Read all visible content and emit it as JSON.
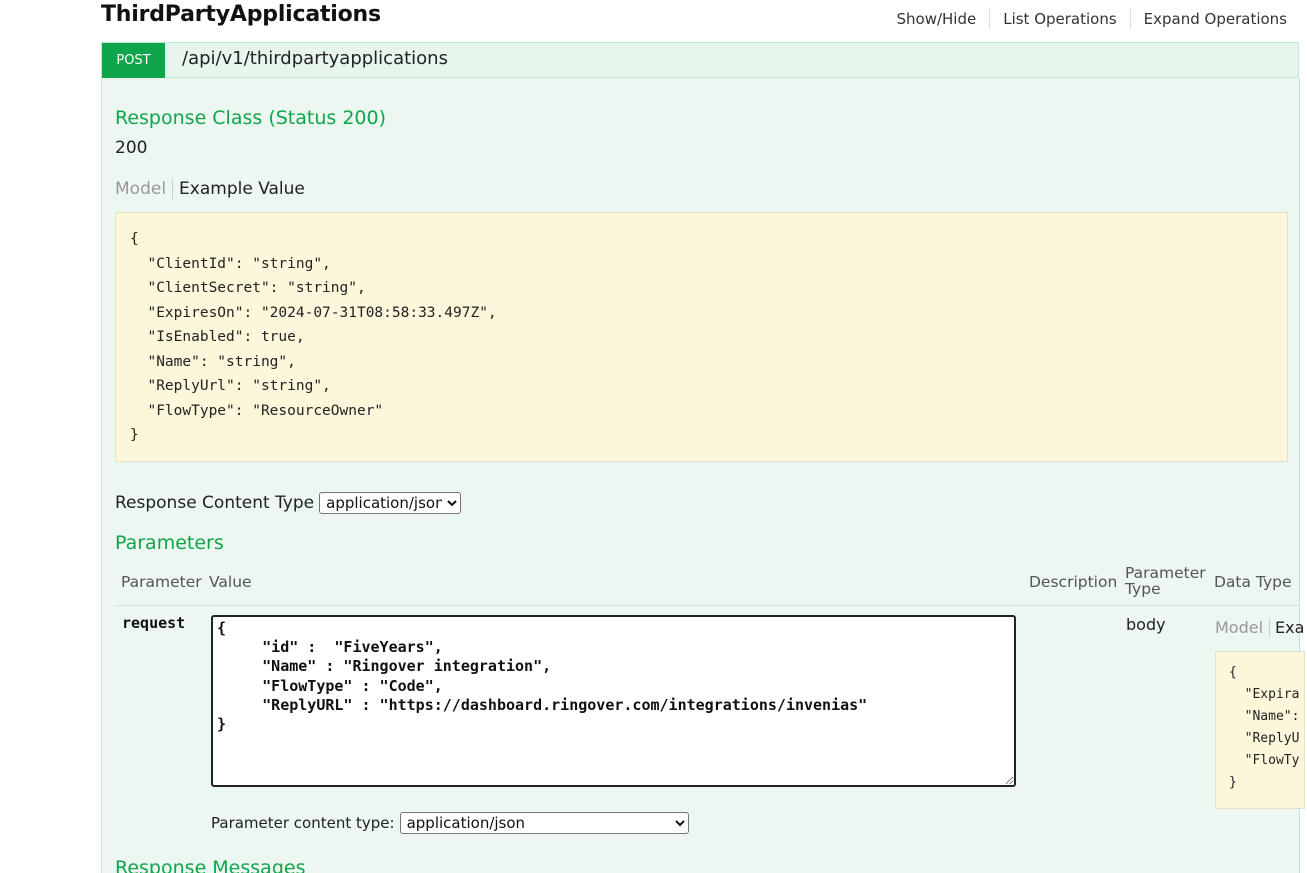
{
  "resource": {
    "title": "ThirdPartyApplications",
    "links": [
      "Show/Hide",
      "List Operations",
      "Expand Operations"
    ]
  },
  "operation": {
    "method": "POST",
    "path": "/api/v1/thirdpartyapplications"
  },
  "response_class": {
    "heading": "Response Class (Status 200)",
    "status_value": "200",
    "tab_model": "Model",
    "tab_example": "Example Value",
    "example_json": "{\n  \"ClientId\": \"string\",\n  \"ClientSecret\": \"string\",\n  \"ExpiresOn\": \"2024-07-31T08:58:33.497Z\",\n  \"IsEnabled\": true,\n  \"Name\": \"string\",\n  \"ReplyUrl\": \"string\",\n  \"FlowType\": \"ResourceOwner\"\n}"
  },
  "response_content_type": {
    "label": "Response Content Type",
    "selected": "application/json"
  },
  "parameters": {
    "heading": "Parameters",
    "columns": [
      "Parameter",
      "Value",
      "Description",
      "Parameter\nType",
      "Data Type"
    ],
    "col_parameter": "Parameter",
    "col_value": "Value",
    "col_description": "Description",
    "col_param_type_1": "Parameter",
    "col_param_type_2": "Type",
    "col_data_type": "Data Type",
    "row": {
      "name": "request",
      "value": "{\n     \"id\" :  \"FiveYears\",\n     \"Name\" : \"Ringover integration\",\n     \"FlowType\" : \"Code\",\n     \"ReplyURL\" : \"https://dashboard.ringover.com/integrations/invenias\"\n}",
      "param_type": "body",
      "tab_model": "Model",
      "tab_example": "Exa",
      "data_type_snippet": "{\n  \"Expira\n  \"Name\":\n  \"ReplyU\n  \"FlowTy\n}",
      "content_type_label": "Parameter content type:",
      "content_type_selected": "application/json"
    }
  },
  "response_messages": {
    "heading": "Response Messages"
  },
  "colors": {
    "accent_green": "#10a54a",
    "panel_bg": "#ebf7f0",
    "snippet_bg": "#fcf6db"
  }
}
